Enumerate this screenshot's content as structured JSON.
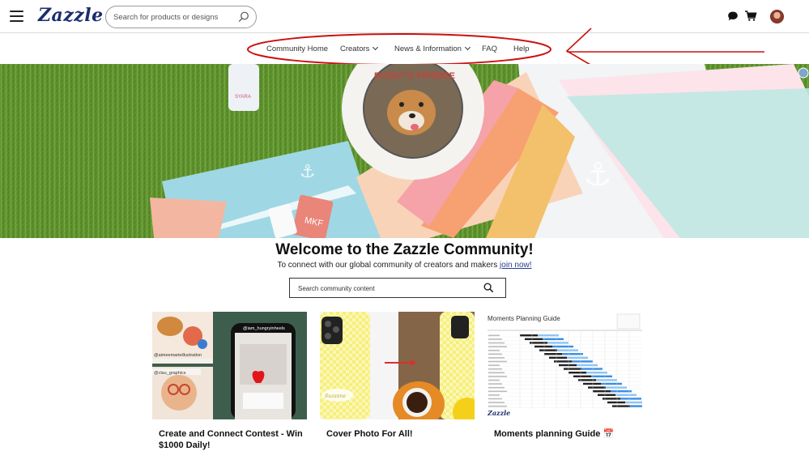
{
  "header": {
    "logo": "Zazzle",
    "search_placeholder": "Search for products or designs"
  },
  "subnav": {
    "items": [
      {
        "label": "Community Home"
      },
      {
        "label": "Creators"
      },
      {
        "label": "News & Information"
      },
      {
        "label": "FAQ"
      },
      {
        "label": "Help"
      }
    ]
  },
  "hero": {
    "frisbee_text": "BUDDY'S FRISBEE",
    "card_text": "MKF"
  },
  "welcome": {
    "title": "Welcome to the Zazzle Community!",
    "subtitle": "To connect with our global community of creators and makers ",
    "join_link": "join now!",
    "search_placeholder": "Search community content"
  },
  "cards": [
    {
      "title": "Create and Connect Contest - Win $1000 Daily!",
      "tag1": "@aimeemarieillustration",
      "tag2": "@iam_hungryinheels",
      "tag3": "@clau_graphics"
    },
    {
      "title": "Cover Photo For All!",
      "phone_text": "Suzanne"
    },
    {
      "title": "Moments planning Guide 📅",
      "guide_heading": "Moments Planning Guide",
      "brand": "Zazzle"
    }
  ],
  "colors": {
    "logo_blue": "#1a2e6e",
    "annotation_red": "#cc1111",
    "link_blue": "#2a3f8a"
  }
}
